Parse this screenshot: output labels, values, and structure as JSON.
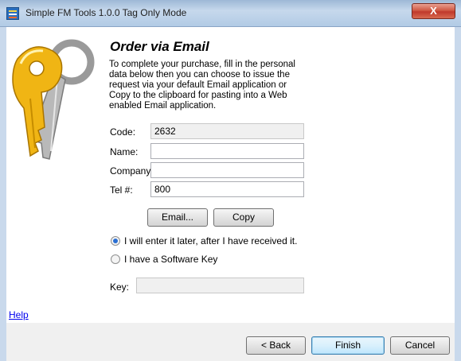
{
  "window": {
    "title": "Simple FM Tools 1.0.0  Tag Only Mode",
    "close_label": "X"
  },
  "page": {
    "heading": "Order via Email",
    "intro": "To complete your purchase, fill in the personal data below then you can choose to issue the request via your default Email application or Copy to the clipboard for pasting into a Web enabled Email application."
  },
  "form": {
    "code_label": "Code:",
    "code_value": "2632",
    "name_label": "Name:",
    "name_value": "",
    "company_label": "Company:",
    "company_value": "",
    "tel_label": "Tel #:",
    "tel_value": "800",
    "email_button": "Email...",
    "copy_button": "Copy"
  },
  "options": {
    "later_label": "I will enter it later, after I have received it.",
    "later_selected": true,
    "software_key_label": "I have a Software Key",
    "software_key_selected": false,
    "key_label": "Key:",
    "key_value": ""
  },
  "footer": {
    "help_link": "Help",
    "back_button": "< Back",
    "finish_button": "Finish",
    "cancel_button": "Cancel"
  },
  "icons": {
    "app": "app-icon",
    "keys": "keys-icon"
  },
  "colors": {
    "title_gradient_start": "#9db8d6",
    "close_button": "#c0392b",
    "key_gold": "#f0b514",
    "link": "#0000ee"
  }
}
